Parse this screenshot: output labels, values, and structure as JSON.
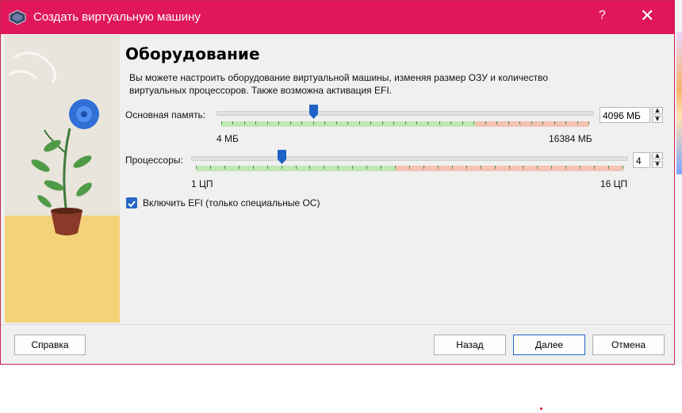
{
  "window": {
    "title": "Создать виртуальную машину",
    "help": "?",
    "close": "✕"
  },
  "page": {
    "heading": "Оборудование",
    "description": "Вы можете настроить оборудование виртуальной машины, изменяя размер ОЗУ и количество виртуальных процессоров. Также возможна активация EFI."
  },
  "memory": {
    "label": "Основная память:",
    "value": "4096 МБ",
    "min_label": "4 МБ",
    "max_label": "16384 МБ",
    "value_mb": 4096,
    "max_mb": 16384
  },
  "cpu": {
    "label": "Процессоры:",
    "value": "4",
    "min_label": "1 ЦП",
    "max_label": "16 ЦП",
    "count": 4,
    "max": 16
  },
  "efi": {
    "label": "Включить EFI (только специальные ОС)",
    "checked": true
  },
  "buttons": {
    "help": "Справка",
    "back": "Назад",
    "next": "Далее",
    "cancel": "Отмена"
  },
  "colors": {
    "titlebar": "#e0175a",
    "accent": "#2766c6",
    "zone_green": "#bfe8b4",
    "zone_red": "#f4c3b3"
  }
}
